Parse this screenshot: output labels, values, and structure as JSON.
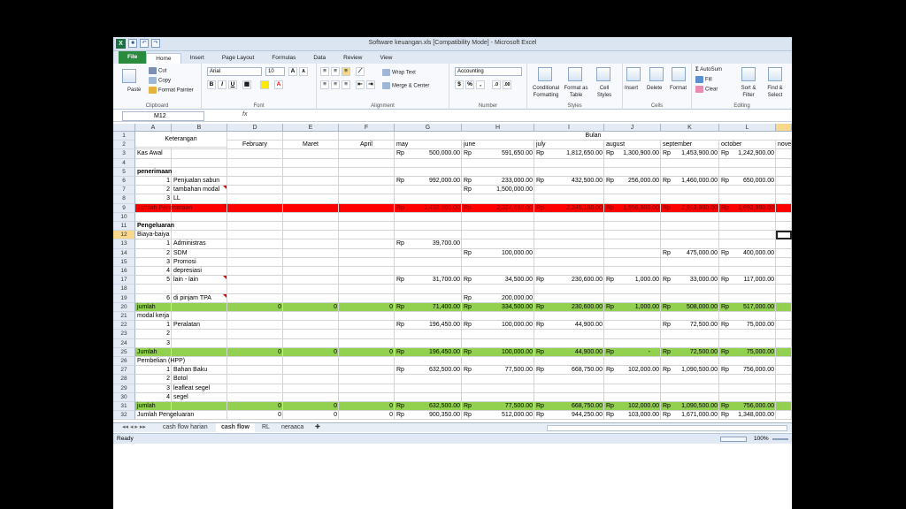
{
  "title": "Software keuangan.xls  [Compatibility Mode]  -  Microsoft Excel",
  "tabs": [
    "File",
    "Home",
    "Insert",
    "Page Layout",
    "Formulas",
    "Data",
    "Review",
    "View"
  ],
  "clipboard": {
    "paste": "Paste",
    "cut": "Cut",
    "copy": "Copy",
    "format_painter": "Format Painter",
    "label": "Clipboard"
  },
  "font": {
    "name": "Arial",
    "size": "10",
    "label": "Font"
  },
  "alignment": {
    "wrap": "Wrap Text",
    "merge": "Merge & Center",
    "label": "Alignment"
  },
  "number": {
    "format": "Accounting",
    "label": "Number"
  },
  "styles": {
    "cond": "Conditional Formatting",
    "table": "Format as Table",
    "cell": "Cell Styles",
    "label": "Styles"
  },
  "cells": {
    "insert": "Insert",
    "delete": "Delete",
    "format": "Format",
    "label": "Cells"
  },
  "editing": {
    "autosum": "AutoSum",
    "fill": "Fill",
    "clear": "Clear",
    "sort": "Sort & Filter",
    "find": "Find & Select",
    "label": "Editing"
  },
  "namebox": "M12",
  "fx": "fx",
  "columns": [
    "A",
    "B",
    "D",
    "E",
    "F",
    "G",
    "H",
    "I",
    "J",
    "K",
    "L"
  ],
  "headers": {
    "keterangan": "Keterangan",
    "bulan": "Bulan",
    "months": [
      "February",
      "Maret",
      "April",
      "may",
      "june",
      "july",
      "august",
      "september",
      "october",
      "nove"
    ]
  },
  "rows": {
    "r3": {
      "label": "Kas Awal",
      "g": "500,000.00",
      "h": "591,650.00",
      "i": "1,812,650.00",
      "j": "1,300,900.00",
      "k": "1,453,900.00",
      "l": "1,242,900.00"
    },
    "r5": "penerimaan",
    "r6": {
      "n": "1",
      "label": "Penjualan sabun",
      "g": "992,000.00",
      "h": "233,000.00",
      "i": "432,500.00",
      "j": "256,000.00",
      "k": "1,460,000.00",
      "l": "650,000.00"
    },
    "r7": {
      "n": "2",
      "label": "tambahan modal",
      "h": "1,500,000.00"
    },
    "r8": {
      "n": "3",
      "label": "LL"
    },
    "r9": {
      "label": "Jumlah Penerimaan",
      "g": "1,492,000.00",
      "h": "2,324,650.00",
      "i": "2,245,150.00",
      "j": "1,556,900.00",
      "k": "2,913,900.00",
      "l": "1,892,900.00"
    },
    "r11": "Pengeluaran",
    "r12": "Biaya-baiya",
    "r13": {
      "n": "1",
      "label": "Administras",
      "g": "39,700.00"
    },
    "r14": {
      "n": "2",
      "label": "SDM",
      "h": "100,000.00",
      "k": "475,000.00",
      "l": "400,000.00"
    },
    "r15": {
      "n": "3",
      "label": "Promosi"
    },
    "r16": {
      "n": "4",
      "label": "depresiasi"
    },
    "r17": {
      "n": "5",
      "label": "lain - lain",
      "g": "31,700.00",
      "h": "34,500.00",
      "i": "230,600.00",
      "j": "1,000.00",
      "k": "33,000.00",
      "l": "117,000.00"
    },
    "r19": {
      "n": "6",
      "label": "di pinjam TPA",
      "h": "200,000.00"
    },
    "r20": {
      "label": "jumlah",
      "d": "0",
      "e": "0",
      "f": "0",
      "g": "71,400.00",
      "h": "334,500.00",
      "i": "230,600.00",
      "j": "1,000.00",
      "k": "508,000.00",
      "l": "517,000.00"
    },
    "r21": "modal kerja",
    "r22": {
      "n": "1",
      "label": "Peralatan",
      "g": "196,450.00",
      "h": "100,000.00",
      "i": "44,900.00",
      "k": "72,500.00",
      "l": "75,000.00"
    },
    "r23": {
      "n": "2"
    },
    "r24": {
      "n": "3"
    },
    "r25": {
      "label": "Jumlah",
      "d": "0",
      "e": "0",
      "f": "0",
      "g": "196,450.00",
      "h": "100,000.00",
      "i": "44,900.00",
      "j": "-",
      "k": "72,500.00",
      "l": "75,000.00"
    },
    "r26": "Pembelian (HPP)",
    "r27": {
      "n": "1",
      "label": "Bahan Baku",
      "g": "632,500.00",
      "h": "77,500.00",
      "i": "668,750.00",
      "j": "102,000.00",
      "k": "1,090,500.00",
      "l": "756,000.00"
    },
    "r28": {
      "n": "2",
      "label": "Botol"
    },
    "r29": {
      "n": "3",
      "label": "leafleat segel"
    },
    "r30": {
      "n": "4",
      "label": "segel"
    },
    "r31": {
      "label": "jumlah",
      "d": "0",
      "e": "0",
      "f": "0",
      "g": "632,500.00",
      "h": "77,500.00",
      "i": "668,750.00",
      "j": "102,000.00",
      "k": "1,090,500.00",
      "l": "756,000.00"
    },
    "r32": {
      "label": "Jumlah Pengeluaran",
      "d": "0",
      "e": "0",
      "f": "0",
      "g": "900,350.00",
      "h": "512,000.00",
      "i": "944,250.00",
      "j": "103,000.00",
      "k": "1,671,000.00",
      "l": "1,348,000.00"
    }
  },
  "rp": "Rp",
  "sheets": [
    "cash flow harian",
    "cash flow",
    "RL",
    "neraaca"
  ],
  "status": {
    "ready": "Ready",
    "zoom": "100%"
  },
  "colors": {
    "red": "#ff0000",
    "green": "#92d050"
  }
}
